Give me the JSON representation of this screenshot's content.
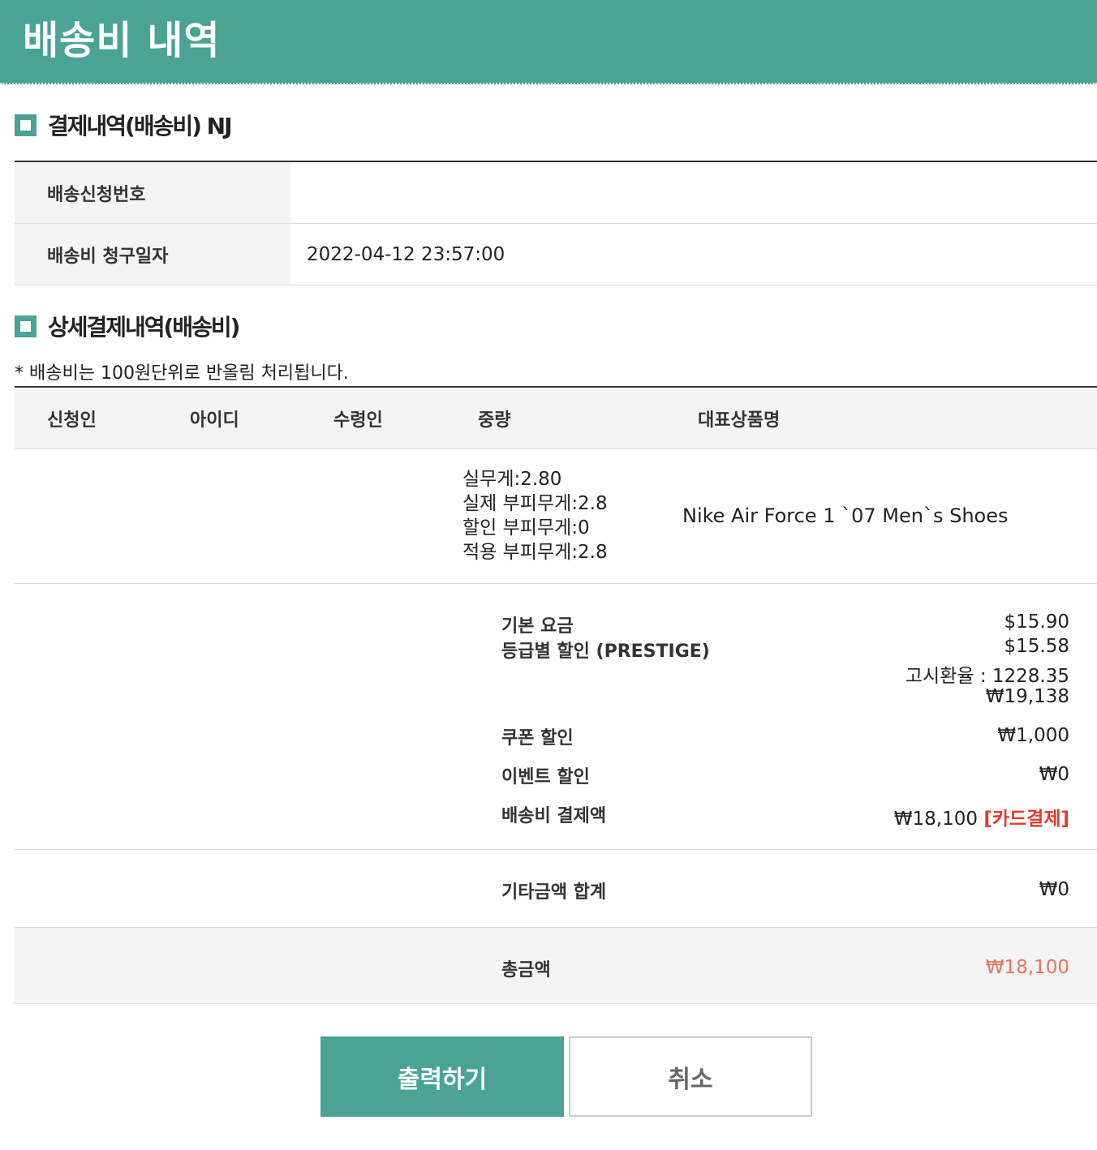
{
  "header": {
    "title": "배송비 내역"
  },
  "payment_section": {
    "title": "결제내역(배송비) NJ",
    "rows": [
      {
        "label": "배송신청번호",
        "value": ""
      },
      {
        "label": "배송비 청구일자",
        "value": "2022-04-12 23:57:00"
      }
    ]
  },
  "detail_section": {
    "title": "상세결제내역(배송비)",
    "note": "* 배송비는 100원단위로 반올림 처리됩니다.",
    "columns": [
      "신청인",
      "아이디",
      "수령인",
      "중량",
      "대표상품명"
    ],
    "item": {
      "applicant": "",
      "user_id": "",
      "recipient": "",
      "weights": [
        "실무게:2.80",
        "실제 부피무게:2.8",
        "할인 부피무게:0",
        "적용 부피무게:2.8"
      ],
      "product_name": "Nike Air Force 1 `07 Men`s Shoes"
    },
    "fees": {
      "base_label": "기본 요금",
      "base_value": "$15.90",
      "grade_label": "등급별 할인 (PRESTIGE)",
      "grade_value": "$15.58",
      "exchange_rate": "고시환율 : 1228.35",
      "krw_value": "₩19,138",
      "coupon_label": "쿠폰 할인",
      "coupon_value": "₩1,000",
      "event_label": "이벤트 할인",
      "event_value": "₩0",
      "payment_label": "배송비 결제액",
      "payment_value": "₩18,100",
      "payment_method": "[카드결제]"
    },
    "etc": {
      "label": "기타금액 합계",
      "value": "₩0"
    },
    "total": {
      "label": "총금액",
      "value": "₩18,100"
    }
  },
  "buttons": {
    "print": "출력하기",
    "cancel": "취소"
  },
  "colors": {
    "accent": "#4aa395",
    "alert": "#e03b2e",
    "total": "#e8735f"
  }
}
